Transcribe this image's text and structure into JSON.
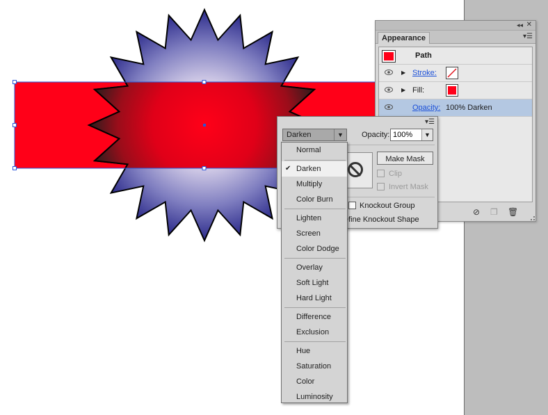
{
  "appearance": {
    "tab": "Appearance",
    "collapse_icon": "double-chevron-left-icon",
    "close_icon": "close-icon",
    "menu_icon": "panel-menu-icon",
    "header_label": "Path",
    "rows": [
      {
        "label": "Stroke:",
        "swatch": "none"
      },
      {
        "label": "Fill:",
        "swatch": "#ff0018"
      },
      {
        "label": "Opacity:",
        "value": "100% Darken"
      }
    ],
    "footer_icons": [
      "clear-appearance-icon",
      "duplicate-item-icon",
      "delete-icon"
    ]
  },
  "transparency": {
    "blend_mode": "Darken",
    "opacity_label": "Opacity:",
    "opacity_value": "100%",
    "make_mask": "Make Mask",
    "clip": "Clip",
    "invert_mask": "Invert Mask",
    "knockout_group": "Knockout Group",
    "define_knockout": "efine Knockout Shape"
  },
  "blend_menu": {
    "groups": [
      [
        "Normal"
      ],
      [
        "Darken",
        "Multiply",
        "Color Burn"
      ],
      [
        "Lighten",
        "Screen",
        "Color Dodge"
      ],
      [
        "Overlay",
        "Soft Light",
        "Hard Light"
      ],
      [
        "Difference",
        "Exclusion"
      ],
      [
        "Hue",
        "Saturation",
        "Color",
        "Luminosity"
      ]
    ],
    "selected": "Darken"
  },
  "colors": {
    "rectangle_fill": "#ff0018",
    "star_center": "#ece6f4",
    "star_edge": "#2b2a8a",
    "selection": "#2a55d8",
    "panel_bg": "#d6d6d6",
    "pasteboard": "#bdbdbd"
  }
}
